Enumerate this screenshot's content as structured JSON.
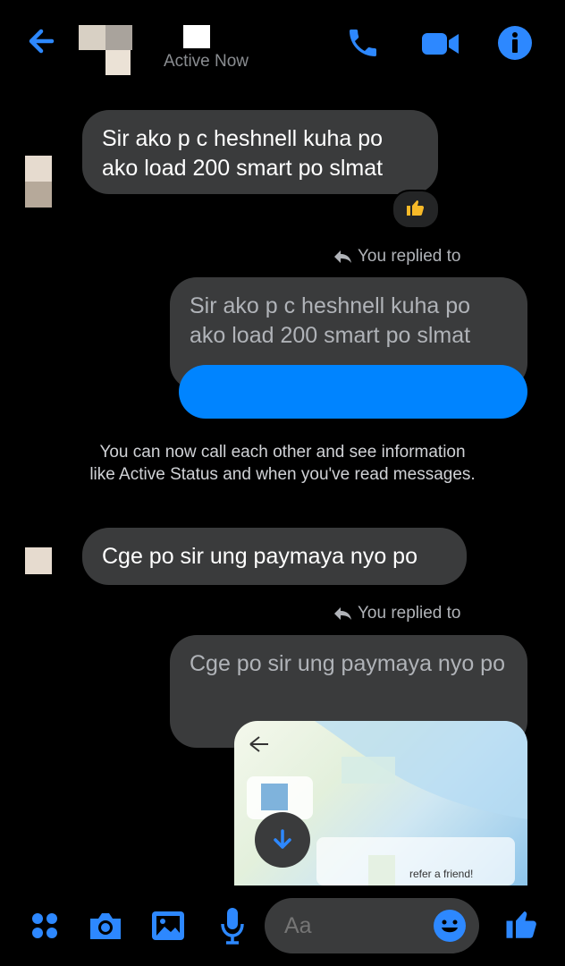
{
  "header": {
    "status": "Active Now",
    "colors": {
      "accent": "#0084ff"
    },
    "icons": [
      "back-arrow-icon",
      "phone-icon",
      "video-camera-icon",
      "info-icon"
    ]
  },
  "messages": {
    "msg1": "Sir ako p c heshnell kuha po ako load 200 smart po slmat",
    "replied1": "You replied to",
    "quote1": "Sir ako p c heshnell kuha po ako load 200 smart po slmat",
    "notice": "You can now call each other and see information like Active Status and when you've read messages.",
    "msg2": "Cge po sir ung paymaya nyo po",
    "replied2": "You replied to",
    "quote2": "Cge po sir ung paymaya nyo po",
    "image_caption": "refer a friend!"
  },
  "composer": {
    "placeholder": "Aa",
    "icons": [
      "apps-icon",
      "camera-icon",
      "gallery-icon",
      "microphone-icon",
      "emoji-icon",
      "thumbs-up-icon"
    ]
  }
}
